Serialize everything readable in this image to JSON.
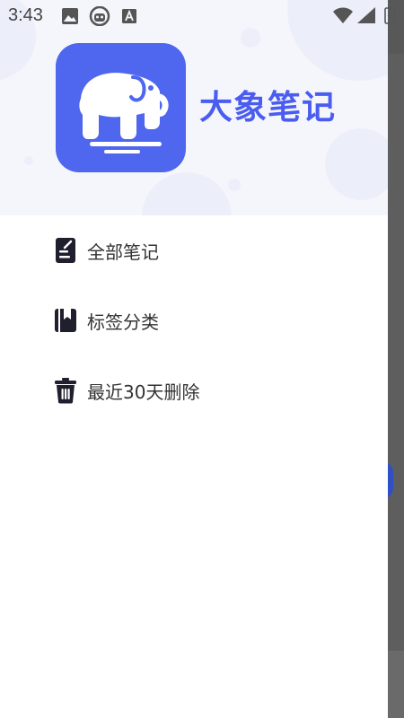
{
  "status_bar": {
    "time": "3:43",
    "icons": [
      "image-icon",
      "headset-robot-icon",
      "keyboard-a-icon",
      "wifi-icon",
      "signal-icon",
      "battery-charging-icon"
    ]
  },
  "app": {
    "name": "大象笔记",
    "logo_icon": "elephant-icon",
    "accent": "#4a5df0",
    "logo_bg": "#4f66ee"
  },
  "menu": {
    "items": [
      {
        "label": "全部笔记",
        "icon": "note-icon"
      },
      {
        "label": "标签分类",
        "icon": "bookmark-book-icon"
      },
      {
        "label": "最近30天删除",
        "icon": "trash-icon"
      }
    ]
  }
}
